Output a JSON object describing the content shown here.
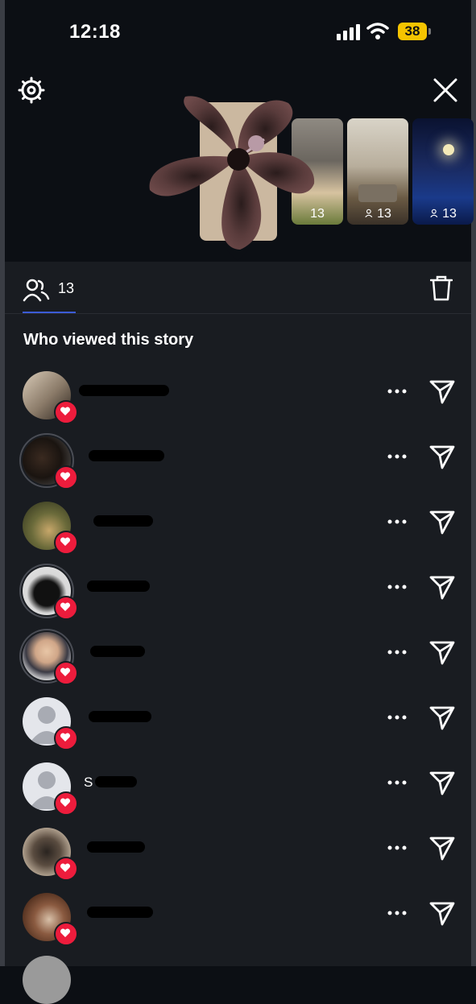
{
  "status_bar": {
    "time": "12:18",
    "battery": "38",
    "battery_color": "#f5c400"
  },
  "top_bar": {
    "settings_icon": "gear-icon",
    "close_icon": "close-icon"
  },
  "story_strip": {
    "items": [
      {
        "viewers": "13"
      },
      {
        "viewers": "13"
      },
      {
        "viewers": "13"
      }
    ]
  },
  "tabs": {
    "viewers_count": "13",
    "accent_color": "#3b5bd6"
  },
  "section_title": "Who viewed this story",
  "viewers": [
    {
      "name_visible": "",
      "liked": true,
      "avatar": "photo"
    },
    {
      "name_visible": "",
      "liked": true,
      "avatar": "photo"
    },
    {
      "name_visible": "",
      "liked": true,
      "avatar": "photo"
    },
    {
      "name_visible": "",
      "liked": true,
      "avatar": "photo"
    },
    {
      "name_visible": "",
      "liked": true,
      "avatar": "photo"
    },
    {
      "name_visible": "",
      "liked": true,
      "avatar": "default"
    },
    {
      "name_visible": "S",
      "liked": true,
      "avatar": "default"
    },
    {
      "name_visible": "",
      "liked": true,
      "avatar": "photo"
    },
    {
      "name_visible": "",
      "liked": true,
      "avatar": "photo"
    }
  ],
  "colors": {
    "like_red": "#ed1c3c",
    "panel_bg": "#191c21"
  }
}
